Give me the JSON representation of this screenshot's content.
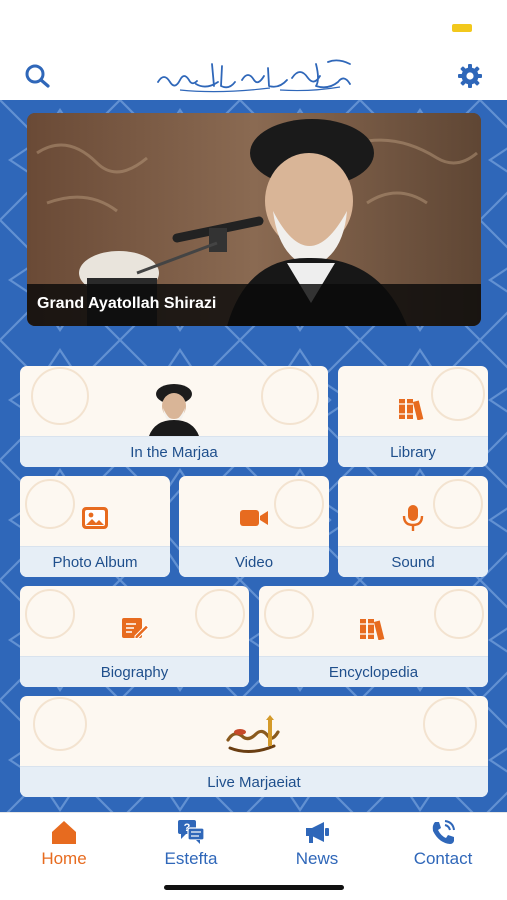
{
  "colors": {
    "primary_blue": "#2f67b9",
    "accent_orange": "#e76b1f",
    "tile_label_bg": "#e6eef6",
    "banner_caption_bg": "#111111"
  },
  "header": {
    "search_icon": "search-icon",
    "settings_icon": "gear-icon",
    "logo_icon": "calligraphy-logo"
  },
  "banner": {
    "caption": "Grand Ayatollah Shirazi"
  },
  "tiles": [
    {
      "label": "In the Marjaa",
      "icon": "portrait-icon"
    },
    {
      "label": "Library",
      "icon": "books-icon"
    },
    {
      "label": "Photo Album",
      "icon": "image-icon"
    },
    {
      "label": "Video",
      "icon": "video-camera-icon"
    },
    {
      "label": "Sound",
      "icon": "microphone-icon"
    },
    {
      "label": "Biography",
      "icon": "edit-document-icon"
    },
    {
      "label": "Encyclopedia",
      "icon": "books-icon"
    },
    {
      "label": "Live Marjaeiat",
      "icon": "marjaeiat-logo"
    }
  ],
  "tabs": [
    {
      "label": "Home",
      "icon": "home-icon",
      "active": true
    },
    {
      "label": "Estefta",
      "icon": "question-chat-icon",
      "active": false
    },
    {
      "label": "News",
      "icon": "megaphone-icon",
      "active": false
    },
    {
      "label": "Contact",
      "icon": "phone-icon",
      "active": false
    }
  ]
}
